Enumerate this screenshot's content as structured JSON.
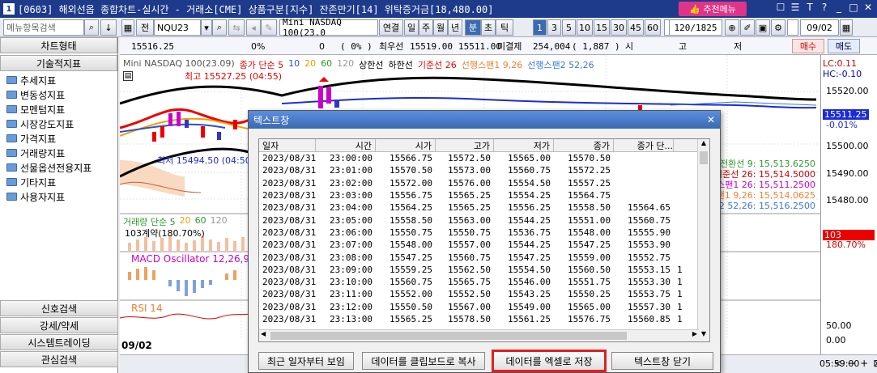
{
  "titlebar": {
    "num": "1",
    "title": "[0603] 해외선옵 종합차트-실시간 - 거래소[CME] 상품구분[지수] 잔존만기[14] 위탁증거금[18,480.00]",
    "recommend_label": "추천메뉴"
  },
  "toolbar": {
    "menu_search": "메뉴항목검색",
    "all_label": "전",
    "symbol": "NQU23",
    "product_name": "Mini NASDAQ 100(23.0",
    "cont_label": "연결",
    "day_label": "일",
    "week_label": "주",
    "month_label": "월",
    "year_label": "년",
    "minute_label": "분",
    "second_label": "초",
    "tick_label": "틱",
    "intervals": [
      "1",
      "3",
      "5",
      "10",
      "15",
      "30",
      "45",
      "60"
    ],
    "period_value": "1",
    "count_value": "120/1825",
    "date_value": "09/02"
  },
  "quote": {
    "price": "15516.25",
    "pct": "0%",
    "change": "0",
    "rate": "( 0% )",
    "best_ask_label": "최우선",
    "best_ask": "15519.00",
    "best_bid": "15511.00",
    "oi_label": "미결제",
    "oi": "254,004",
    "oi_change": "( 1,887 )",
    "open_label": "시",
    "high_label": "고",
    "low_label": "저",
    "buy_label": "매수",
    "sell_label": "매도"
  },
  "sidebar": {
    "chart_type": "차트형태",
    "tech_indicator": "기술적지표",
    "items": [
      "추세지표",
      "변동성지표",
      "모멘텀지표",
      "시장강도지표",
      "가격지표",
      "거래량지표",
      "선물옵션전용지표",
      "기타지표",
      "사용자지표"
    ],
    "signal_search": "신호검색",
    "strength": "강세/약세",
    "system_trading": "시스템트레이딩",
    "interest_search": "관심검색"
  },
  "chart": {
    "legend_main": "Mini NASDAQ 100(23.09)",
    "legend_close": "종가 단순 5",
    "ma_10": "10",
    "ma_20": "20",
    "ma_60": "60",
    "ma_120": "120",
    "upper": "상한선",
    "lower": "하한선",
    "base": "기준선 26",
    "span1": "선행스팬1 9,26",
    "span2": "선행스팬2 52,26",
    "high_marker": "최고 15527.25 (04:55)",
    "low_marker": "최저 15494.50 (04:50)",
    "volume_label": "거래량 단순 5",
    "vol_20": "20",
    "vol_60": "60",
    "vol_120": "120",
    "volume_value": "103계약(180.70%)",
    "macd_label": "MACD Oscillator 12,26,9",
    "rsi_label": "RSI 14",
    "date_label": "09/02",
    "right_labels": [
      "전환선 9: 15,513.6250",
      "기준선 26: 15,514.5000",
      "스팬1 26: 15,511.2500",
      "스팬1 9,26: 15,514.0625",
      "스팬2 52,26: 15,516.2500"
    ],
    "lc": "LC:0.11",
    "hc": "HC:-0.10",
    "scale_labels": [
      "15520.00",
      "15500.00",
      "15490.00",
      "15480.00",
      "50.00",
      "0.00"
    ],
    "price_tag": "15511.25",
    "price_pct": "-0.01%",
    "vol_tag": "103",
    "vol_pct": "180.70%",
    "time_label": "05:59:00"
  },
  "dialog": {
    "title": "텍스트창",
    "headers": [
      "일자",
      "시간",
      "시가",
      "고가",
      "저가",
      "종가",
      "종가 단..."
    ],
    "rows": [
      [
        "2023/08/31",
        "23:00:00",
        "15566.75",
        "15572.50",
        "15565.00",
        "15570.50",
        "",
        ""
      ],
      [
        "2023/08/31",
        "23:01:00",
        "15570.50",
        "15573.00",
        "15560.75",
        "15572.25",
        "",
        ""
      ],
      [
        "2023/08/31",
        "23:02:00",
        "15572.00",
        "15576.00",
        "15554.50",
        "15557.25",
        "",
        ""
      ],
      [
        "2023/08/31",
        "23:03:00",
        "15556.75",
        "15565.25",
        "15554.25",
        "15564.75",
        "",
        ""
      ],
      [
        "2023/08/31",
        "23:04:00",
        "15564.25",
        "15565.25",
        "15556.25",
        "15558.50",
        "15564.65",
        ""
      ],
      [
        "2023/08/31",
        "23:05:00",
        "15558.50",
        "15563.00",
        "15544.25",
        "15551.00",
        "15560.75",
        ""
      ],
      [
        "2023/08/31",
        "23:06:00",
        "15550.75",
        "15550.75",
        "15536.75",
        "15548.00",
        "15555.90",
        ""
      ],
      [
        "2023/08/31",
        "23:07:00",
        "15548.00",
        "15557.00",
        "15544.25",
        "15547.25",
        "15553.90",
        ""
      ],
      [
        "2023/08/31",
        "23:08:00",
        "15547.25",
        "15560.75",
        "15547.25",
        "15559.00",
        "15552.75",
        ""
      ],
      [
        "2023/08/31",
        "23:09:00",
        "15559.25",
        "15562.50",
        "15554.50",
        "15560.50",
        "15553.15",
        "1"
      ],
      [
        "2023/08/31",
        "23:10:00",
        "15560.75",
        "15565.75",
        "15546.00",
        "15551.75",
        "15553.30",
        "1"
      ],
      [
        "2023/08/31",
        "23:11:00",
        "15552.00",
        "15552.50",
        "15543.25",
        "15550.25",
        "15553.75",
        "1"
      ],
      [
        "2023/08/31",
        "23:12:00",
        "15550.50",
        "15567.00",
        "15549.00",
        "15565.00",
        "15557.30",
        "1"
      ],
      [
        "2023/08/31",
        "23:13:00",
        "15565.25",
        "15578.50",
        "15561.25",
        "15576.75",
        "15560.85",
        "1"
      ]
    ],
    "btn_recent": "최근 일자부터 보임",
    "btn_clipboard": "데이터를 클립보드로 복사",
    "btn_excel": "데이터를 엑셀로 저장",
    "btn_close": "텍스트창 닫기"
  }
}
